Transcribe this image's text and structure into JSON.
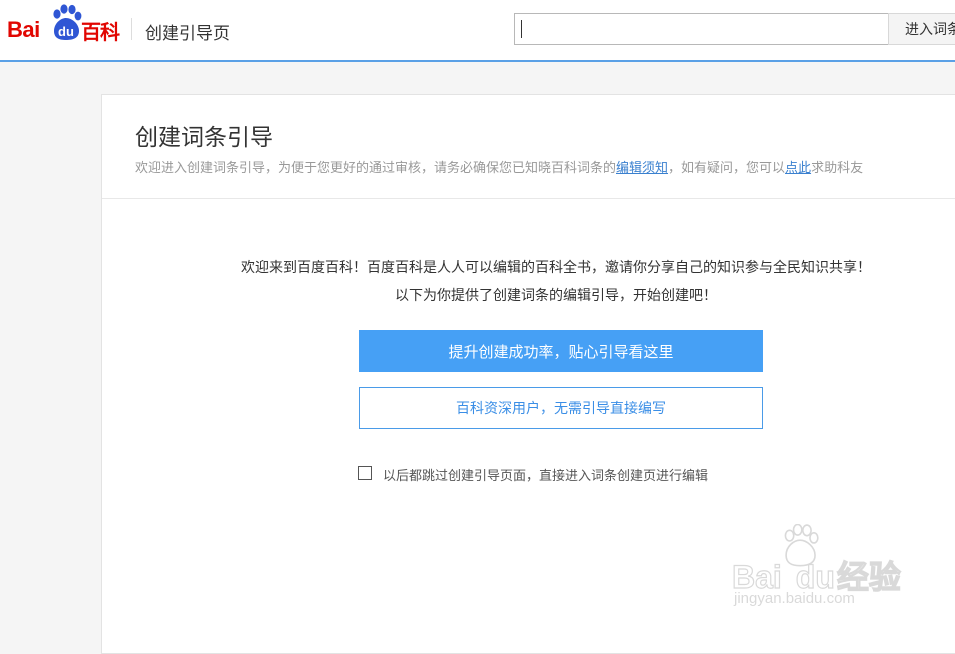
{
  "header": {
    "logo_text_bai": "Bai",
    "logo_text_du": "du",
    "logo_text_baike": "百科",
    "page_title": "创建引导页",
    "search": {
      "value": "",
      "placeholder": ""
    },
    "enter_button_label": "进入词条"
  },
  "panel": {
    "title": "创建词条引导",
    "description": {
      "prefix": "欢迎进入创建词条引导，为便于您更好的通过审核，请务必确保您已知晓百科词条的",
      "link1": "编辑须知",
      "middle": "，如有疑问，您可以",
      "link2": "点此",
      "suffix": "求助科友"
    },
    "welcome_line1": "欢迎来到百度百科！百度百科是人人可以编辑的百科全书，邀请你分享自己的知识参与全民知识共享！",
    "welcome_line2": "以下为你提供了创建词条的编辑引导，开始创建吧！",
    "primary_button": "提升创建成功率，贴心引导看这里",
    "secondary_button": "百科资深用户，无需引导直接编写",
    "skip_label": "以后都跳过创建引导页面，直接进入词条创建页进行编辑",
    "skip_checked": false
  },
  "watermark": {
    "text_bai": "Bai",
    "text_du": "du",
    "text_jingyan": "经验",
    "url": "jingyan.baidu.com"
  },
  "colors": {
    "brand_red": "#e10601",
    "accent_blue": "#46a0f5",
    "link_blue": "#3a80cf"
  }
}
